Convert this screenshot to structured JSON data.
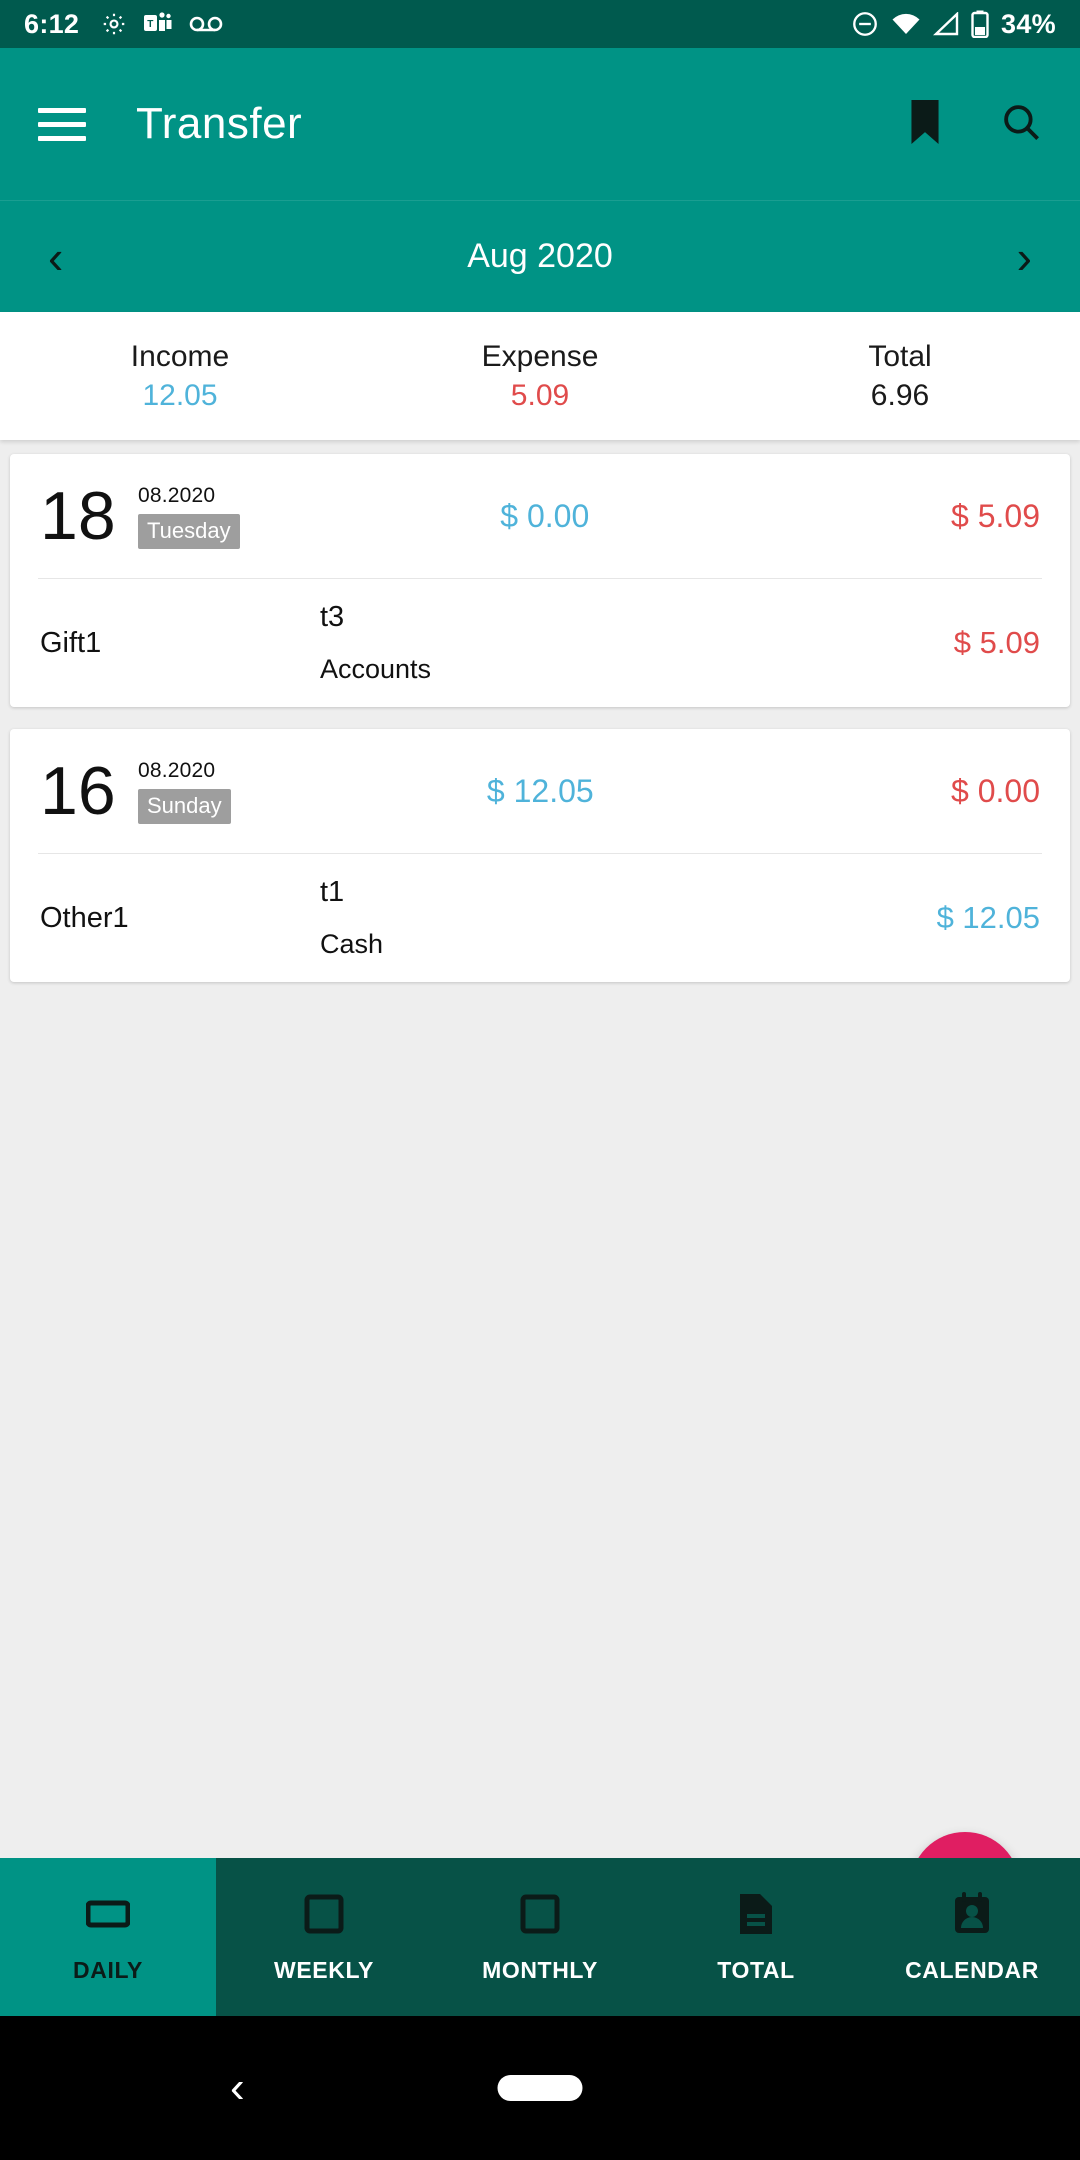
{
  "status_bar": {
    "time": "6:12",
    "battery_percent": "34%",
    "icons": [
      "gear-icon",
      "teams-icon",
      "voicemail-icon",
      "do-not-disturb-icon",
      "wifi-icon",
      "cellular-signal-icon",
      "battery-icon"
    ]
  },
  "app_bar": {
    "title": "Transfer",
    "menu_icon": "hamburger-menu-icon",
    "bookmark_icon": "bookmark-icon",
    "search_icon": "search-icon"
  },
  "month_nav": {
    "prev_label": "‹",
    "label": "Aug 2020",
    "next_label": "›"
  },
  "summary": {
    "income_label": "Income",
    "income_value": "12.05",
    "expense_label": "Expense",
    "expense_value": "5.09",
    "total_label": "Total",
    "total_value": "6.96"
  },
  "days": [
    {
      "day": "18",
      "month_year": "08.2020",
      "weekday": "Tuesday",
      "income": "$ 0.00",
      "expense": "$ 5.09",
      "transactions": [
        {
          "category": "Gift1",
          "note": "t3",
          "account": "Accounts",
          "amount": "$ 5.09",
          "kind": "expense"
        }
      ]
    },
    {
      "day": "16",
      "month_year": "08.2020",
      "weekday": "Sunday",
      "income": "$ 12.05",
      "expense": "$ 0.00",
      "transactions": [
        {
          "category": "Other1",
          "note": "t1",
          "account": "Cash",
          "amount": "$ 12.05",
          "kind": "income"
        }
      ]
    }
  ],
  "fab": {
    "icon": "plus-icon",
    "background_color": "#e01e62",
    "icon_color": "#8bc918"
  },
  "bottom_nav": {
    "items": [
      {
        "label": "DAILY",
        "icon": "daily-rectangle-icon",
        "active": true
      },
      {
        "label": "WEEKLY",
        "icon": "weekly-square-icon",
        "active": false
      },
      {
        "label": "MONTHLY",
        "icon": "monthly-square-icon",
        "active": false
      },
      {
        "label": "TOTAL",
        "icon": "document-icon",
        "active": false
      },
      {
        "label": "CALENDAR",
        "icon": "calendar-contact-icon",
        "active": false
      }
    ]
  },
  "system_nav": {
    "back_icon": "back-chevron-icon",
    "home_icon": "home-pill-icon"
  },
  "colors": {
    "primary": "#009385",
    "primary_dark": "#005a4e",
    "nav_dark": "#075247",
    "income": "#4fb3da",
    "expense": "#e04b4b",
    "accent": "#e01e62"
  }
}
